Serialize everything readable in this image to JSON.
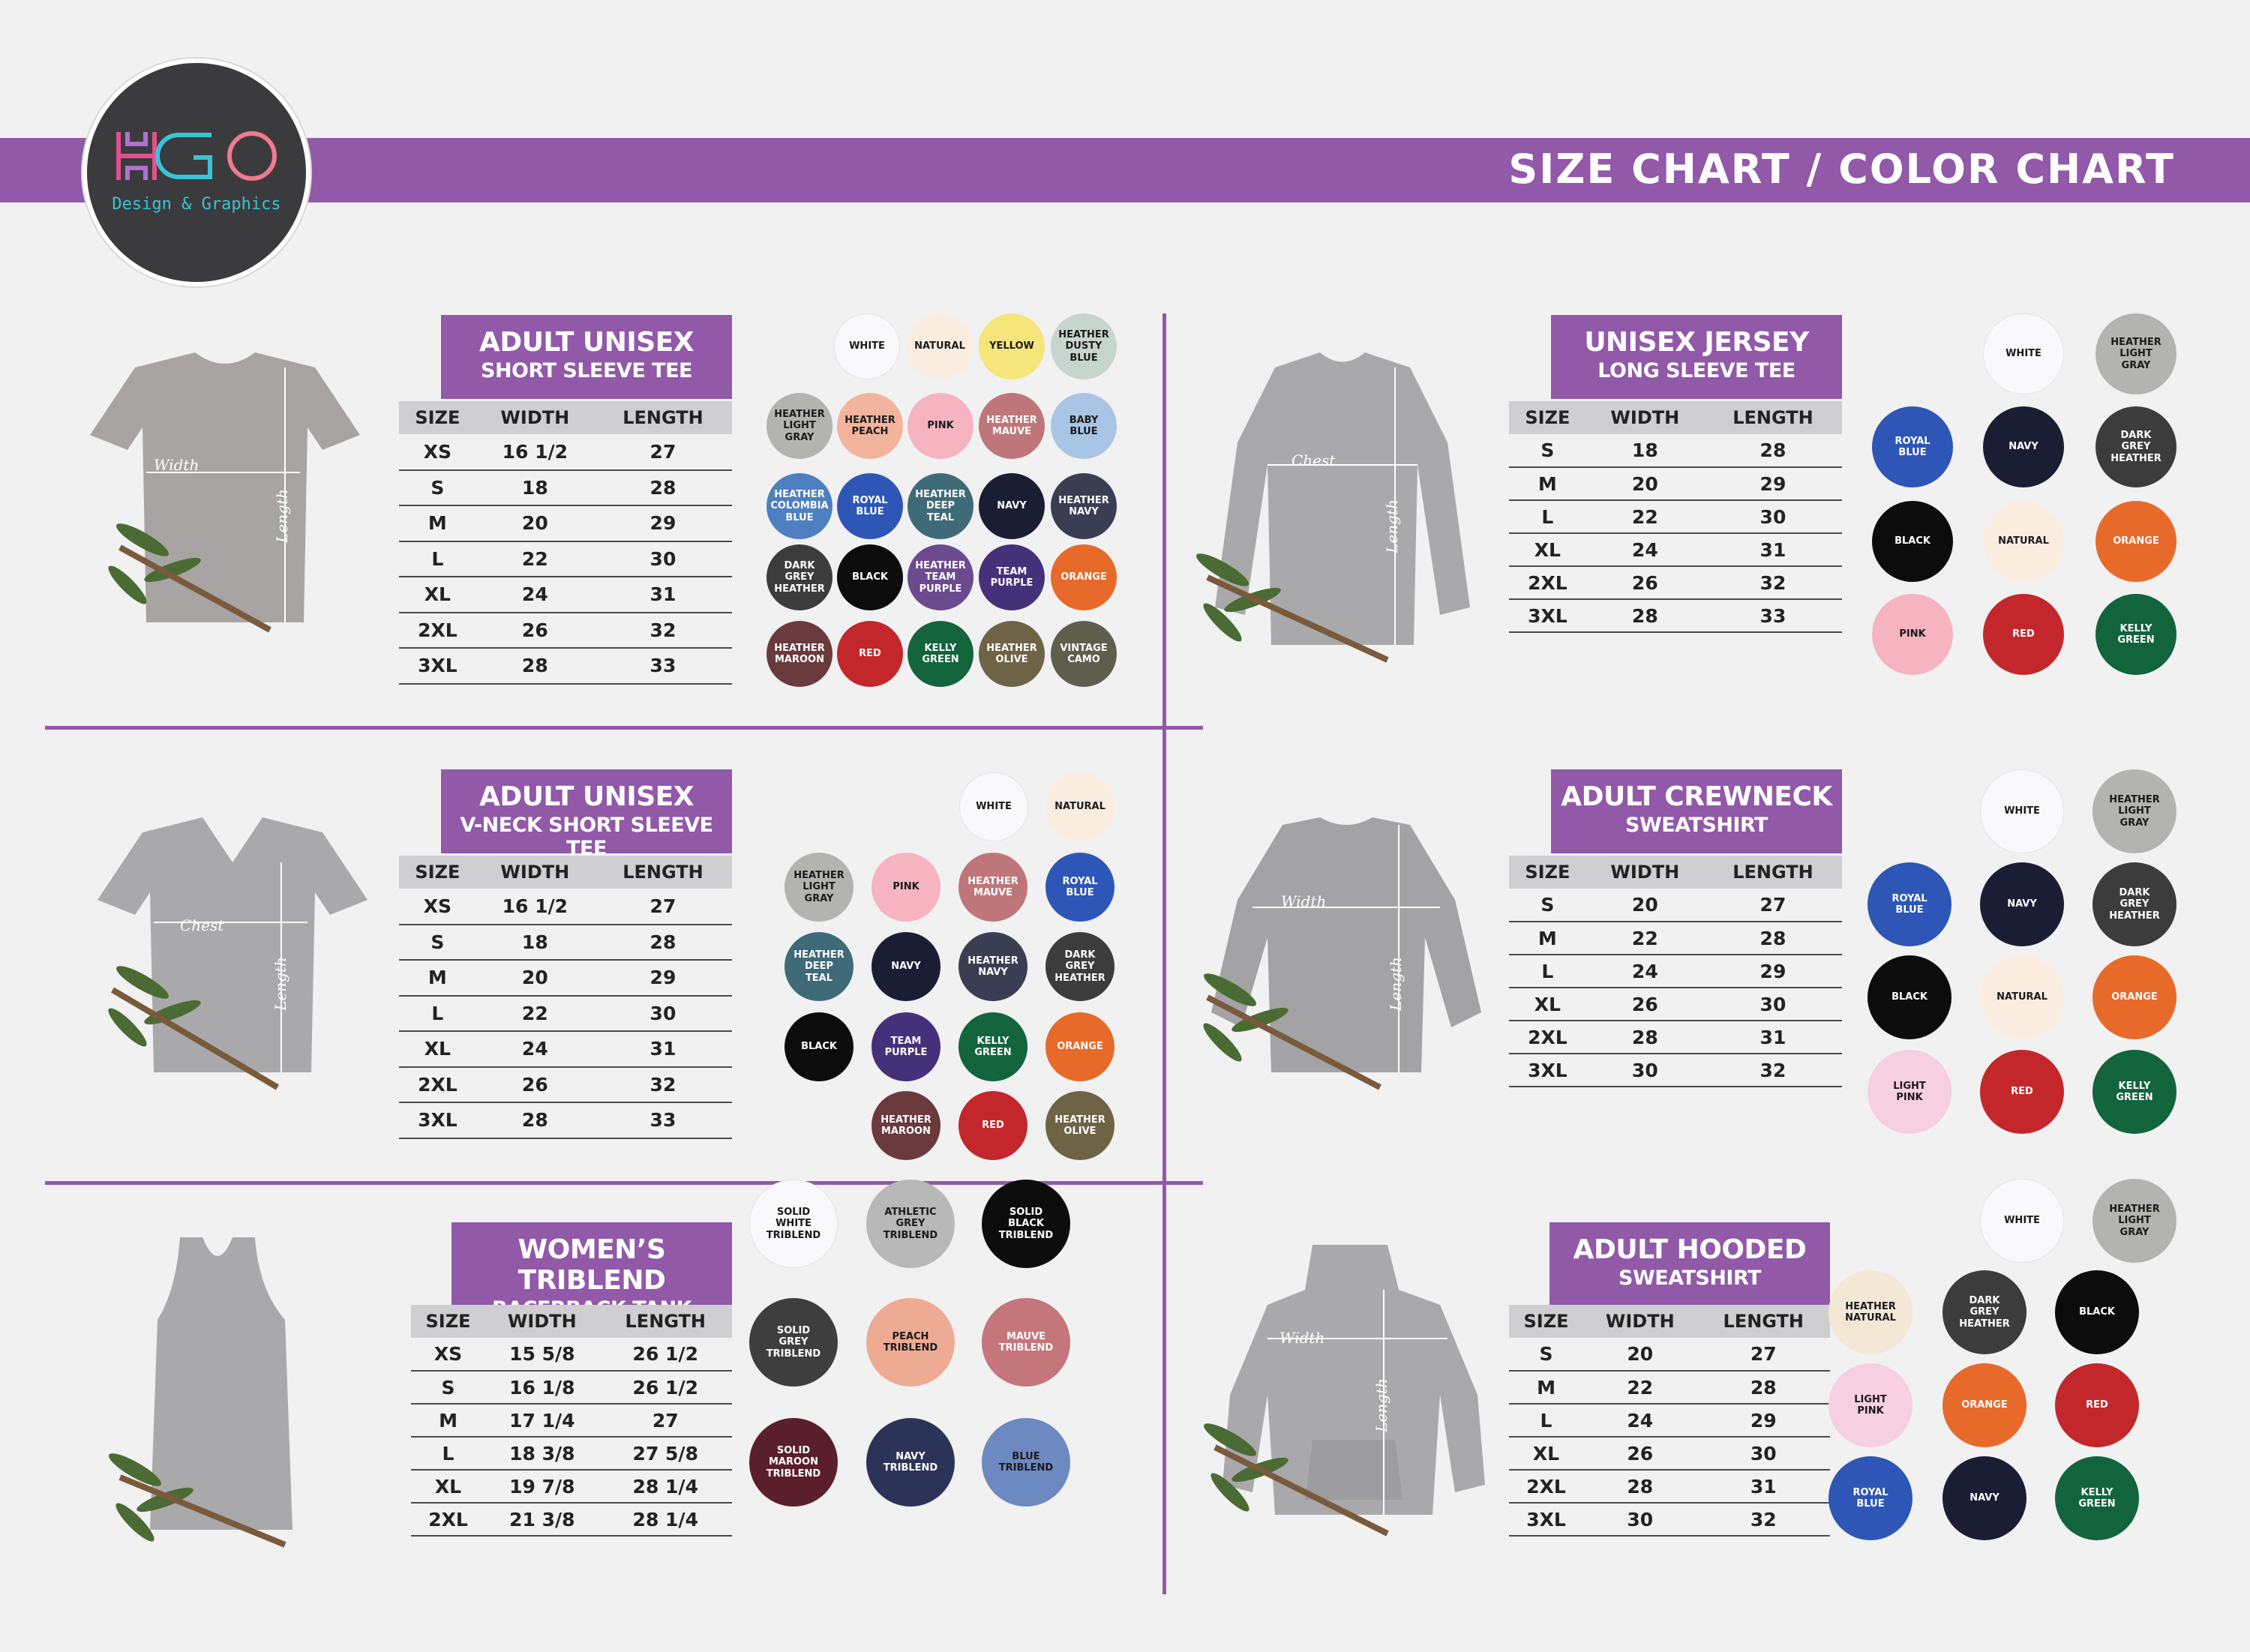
{
  "brand": {
    "logo_text": "Design & Graphics",
    "logo_letters": "HGO"
  },
  "header": {
    "title": "SIZE CHART / COLOR CHART"
  },
  "headers": {
    "size": "SIZE",
    "width": "WIDTH",
    "length": "LENGTH"
  },
  "products": [
    {
      "id": "p1",
      "title_line1": "ADULT UNISEX",
      "title_line2": "SHORT SLEEVE TEE",
      "photo": {
        "kind": "tshirt",
        "width_label": "Width",
        "length_label": "Length"
      },
      "rows": [
        [
          "XS",
          "16 1/2",
          "27"
        ],
        [
          "S",
          "18",
          "28"
        ],
        [
          "M",
          "20",
          "29"
        ],
        [
          "L",
          "22",
          "30"
        ],
        [
          "XL",
          "24",
          "31"
        ],
        [
          "2XL",
          "26",
          "32"
        ],
        [
          "3XL",
          "28",
          "33"
        ]
      ],
      "colors": [
        {
          "name": "WHITE",
          "hex": "#f9f9fb",
          "text": "#1a1a1a"
        },
        {
          "name": "NATURAL",
          "hex": "#faede0",
          "text": "#1a1a1a"
        },
        {
          "name": "YELLOW",
          "hex": "#f5e57a",
          "text": "#1a1a1a"
        },
        {
          "name": "HEATHER\nDUSTY\nBLUE",
          "hex": "#c7d5cf",
          "text": "#1a1a1a"
        },
        {
          "name": "HEATHER\nLIGHT\nGRAY",
          "hex": "#b3b3b1",
          "text": "#1a1a1a"
        },
        {
          "name": "HEATHER\nPEACH",
          "hex": "#f2b49c",
          "text": "#1a1a1a"
        },
        {
          "name": "PINK",
          "hex": "#f5b4bf",
          "text": "#1a1a1a"
        },
        {
          "name": "HEATHER\nMAUVE",
          "hex": "#bf767a",
          "text": "#ffffff"
        },
        {
          "name": "BABY\nBLUE",
          "hex": "#a9c5e5",
          "text": "#1a1a1a"
        },
        {
          "name": "HEATHER\nCOLOMBIA\nBLUE",
          "hex": "#4e7fc0",
          "text": "#ffffff"
        },
        {
          "name": "ROYAL\nBLUE",
          "hex": "#2d56b6",
          "text": "#ffffff"
        },
        {
          "name": "HEATHER\nDEEP\nTEAL",
          "hex": "#3f6a78",
          "text": "#ffffff"
        },
        {
          "name": "NAVY",
          "hex": "#1a1d33",
          "text": "#ffffff"
        },
        {
          "name": "HEATHER\nNAVY",
          "hex": "#3b3e52",
          "text": "#ffffff"
        },
        {
          "name": "DARK\nGREY\nHEATHER",
          "hex": "#3c3c3c",
          "text": "#ffffff"
        },
        {
          "name": "BLACK",
          "hex": "#0c0c0c",
          "text": "#ffffff"
        },
        {
          "name": "HEATHER\nTEAM\nPURPLE",
          "hex": "#6b4b8d",
          "text": "#ffffff"
        },
        {
          "name": "TEAM\nPURPLE",
          "hex": "#45307a",
          "text": "#ffffff"
        },
        {
          "name": "ORANGE",
          "hex": "#e86a2a",
          "text": "#ffffff"
        },
        {
          "name": "HEATHER\nMAROON",
          "hex": "#6b3a3d",
          "text": "#ffffff"
        },
        {
          "name": "RED",
          "hex": "#c3272c",
          "text": "#ffffff"
        },
        {
          "name": "KELLY\nGREEN",
          "hex": "#12643c",
          "text": "#ffffff"
        },
        {
          "name": "HEATHER\nOLIVE",
          "hex": "#6e6445",
          "text": "#ffffff"
        },
        {
          "name": "VINTAGE\nCAMO",
          "hex": "#5e5e4c",
          "text": "#ffffff"
        }
      ]
    },
    {
      "id": "p2",
      "title_line1": "UNISEX JERSEY",
      "title_line2": "LONG SLEEVE TEE",
      "photo": {
        "kind": "longsleeve",
        "width_label": "Chest",
        "length_label": "Length"
      },
      "rows": [
        [
          "S",
          "18",
          "28"
        ],
        [
          "M",
          "20",
          "29"
        ],
        [
          "L",
          "22",
          "30"
        ],
        [
          "XL",
          "24",
          "31"
        ],
        [
          "2XL",
          "26",
          "32"
        ],
        [
          "3XL",
          "28",
          "33"
        ]
      ],
      "colors": [
        {
          "name": "WHITE",
          "hex": "#f9f9fb",
          "text": "#1a1a1a"
        },
        {
          "name": "HEATHER\nLIGHT\nGRAY",
          "hex": "#b3b3b1",
          "text": "#1a1a1a"
        },
        {
          "name": "ROYAL\nBLUE",
          "hex": "#2d56b6",
          "text": "#ffffff"
        },
        {
          "name": "NAVY",
          "hex": "#1a1d33",
          "text": "#ffffff"
        },
        {
          "name": "DARK\nGREY\nHEATHER",
          "hex": "#3c3c3c",
          "text": "#ffffff"
        },
        {
          "name": "BLACK",
          "hex": "#0c0c0c",
          "text": "#ffffff"
        },
        {
          "name": "NATURAL",
          "hex": "#faede0",
          "text": "#1a1a1a"
        },
        {
          "name": "ORANGE",
          "hex": "#e86a2a",
          "text": "#ffffff"
        },
        {
          "name": "PINK",
          "hex": "#f5b4bf",
          "text": "#1a1a1a"
        },
        {
          "name": "RED",
          "hex": "#c3272c",
          "text": "#ffffff"
        },
        {
          "name": "KELLY\nGREEN",
          "hex": "#12643c",
          "text": "#ffffff"
        }
      ]
    },
    {
      "id": "p3",
      "title_line1": "ADULT UNISEX",
      "title_line2": "V-NECK SHORT SLEEVE TEE",
      "photo": {
        "kind": "vneck",
        "width_label": "Chest",
        "length_label": "Length"
      },
      "rows": [
        [
          "XS",
          "16 1/2",
          "27"
        ],
        [
          "S",
          "18",
          "28"
        ],
        [
          "M",
          "20",
          "29"
        ],
        [
          "L",
          "22",
          "30"
        ],
        [
          "XL",
          "24",
          "31"
        ],
        [
          "2XL",
          "26",
          "32"
        ],
        [
          "3XL",
          "28",
          "33"
        ]
      ],
      "colors": [
        {
          "name": "WHITE",
          "hex": "#f9f9fb",
          "text": "#1a1a1a"
        },
        {
          "name": "NATURAL",
          "hex": "#faede0",
          "text": "#1a1a1a"
        },
        {
          "name": "HEATHER\nLIGHT\nGRAY",
          "hex": "#b3b3b1",
          "text": "#1a1a1a"
        },
        {
          "name": "PINK",
          "hex": "#f5b4bf",
          "text": "#1a1a1a"
        },
        {
          "name": "HEATHER\nMAUVE",
          "hex": "#bf767a",
          "text": "#ffffff"
        },
        {
          "name": "ROYAL\nBLUE",
          "hex": "#2d56b6",
          "text": "#ffffff"
        },
        {
          "name": "HEATHER\nDEEP\nTEAL",
          "hex": "#3f6a78",
          "text": "#ffffff"
        },
        {
          "name": "NAVY",
          "hex": "#1a1d33",
          "text": "#ffffff"
        },
        {
          "name": "HEATHER\nNAVY",
          "hex": "#3b3e52",
          "text": "#ffffff"
        },
        {
          "name": "DARK\nGREY\nHEATHER",
          "hex": "#3c3c3c",
          "text": "#ffffff"
        },
        {
          "name": "BLACK",
          "hex": "#0c0c0c",
          "text": "#ffffff"
        },
        {
          "name": "TEAM\nPURPLE",
          "hex": "#45307a",
          "text": "#ffffff"
        },
        {
          "name": "KELLY\nGREEN",
          "hex": "#12643c",
          "text": "#ffffff"
        },
        {
          "name": "ORANGE",
          "hex": "#e86a2a",
          "text": "#ffffff"
        },
        {
          "name": "HEATHER\nMAROON",
          "hex": "#6b3a3d",
          "text": "#ffffff"
        },
        {
          "name": "RED",
          "hex": "#c3272c",
          "text": "#ffffff"
        },
        {
          "name": "HEATHER\nOLIVE",
          "hex": "#6e6445",
          "text": "#ffffff"
        }
      ]
    },
    {
      "id": "p4",
      "title_line1": "ADULT CREWNECK",
      "title_line2": "SWEATSHIRT",
      "photo": {
        "kind": "crewneck",
        "width_label": "Width",
        "length_label": "Length"
      },
      "rows": [
        [
          "S",
          "20",
          "27"
        ],
        [
          "M",
          "22",
          "28"
        ],
        [
          "L",
          "24",
          "29"
        ],
        [
          "XL",
          "26",
          "30"
        ],
        [
          "2XL",
          "28",
          "31"
        ],
        [
          "3XL",
          "30",
          "32"
        ]
      ],
      "colors": [
        {
          "name": "WHITE",
          "hex": "#f9f9fb",
          "text": "#1a1a1a"
        },
        {
          "name": "HEATHER\nLIGHT\nGRAY",
          "hex": "#b3b3b1",
          "text": "#1a1a1a"
        },
        {
          "name": "ROYAL\nBLUE",
          "hex": "#2d56b6",
          "text": "#ffffff"
        },
        {
          "name": "NAVY",
          "hex": "#1a1d33",
          "text": "#ffffff"
        },
        {
          "name": "DARK\nGREY\nHEATHER",
          "hex": "#3c3c3c",
          "text": "#ffffff"
        },
        {
          "name": "BLACK",
          "hex": "#0c0c0c",
          "text": "#ffffff"
        },
        {
          "name": "NATURAL",
          "hex": "#faede0",
          "text": "#1a1a1a"
        },
        {
          "name": "ORANGE",
          "hex": "#e86a2a",
          "text": "#ffffff"
        },
        {
          "name": "LIGHT\nPINK",
          "hex": "#f6cfe0",
          "text": "#1a1a1a"
        },
        {
          "name": "RED",
          "hex": "#c3272c",
          "text": "#ffffff"
        },
        {
          "name": "KELLY\nGREEN",
          "hex": "#12643c",
          "text": "#ffffff"
        }
      ]
    },
    {
      "id": "p5",
      "title_line1": "WOMEN’S TRIBLEND",
      "title_line2": "RACERBACK TANK",
      "photo": {
        "kind": "tank",
        "width_label": "",
        "length_label": ""
      },
      "rows": [
        [
          "XS",
          "15 5/8",
          "26 1/2"
        ],
        [
          "S",
          "16 1/8",
          "26 1/2"
        ],
        [
          "M",
          "17 1/4",
          "27"
        ],
        [
          "L",
          "18 3/8",
          "27 5/8"
        ],
        [
          "XL",
          "19 7/8",
          "28 1/4"
        ],
        [
          "2XL",
          "21 3/8",
          "28 1/4"
        ]
      ],
      "colors": [
        {
          "name": "SOLID\nWHITE\nTRIBLEND",
          "hex": "#f9f9fb",
          "text": "#1a1a1a"
        },
        {
          "name": "ATHLETIC\nGREY\nTRIBLEND",
          "hex": "#b8b8b8",
          "text": "#1a1a1a"
        },
        {
          "name": "SOLID\nBLACK\nTRIBLEND",
          "hex": "#0c0c0c",
          "text": "#ffffff"
        },
        {
          "name": "SOLID\nGREY\nTRIBLEND",
          "hex": "#3e3e3e",
          "text": "#ffffff"
        },
        {
          "name": "PEACH\nTRIBLEND",
          "hex": "#eeab93",
          "text": "#1a1a1a"
        },
        {
          "name": "MAUVE\nTRIBLEND",
          "hex": "#c4767b",
          "text": "#ffffff"
        },
        {
          "name": "SOLID\nMAROON\nTRIBLEND",
          "hex": "#5a1f2a",
          "text": "#ffffff"
        },
        {
          "name": "NAVY\nTRIBLEND",
          "hex": "#2b3358",
          "text": "#ffffff"
        },
        {
          "name": "BLUE\nTRIBLEND",
          "hex": "#6d89c2",
          "text": "#1a1a1a"
        }
      ]
    },
    {
      "id": "p6",
      "title_line1": "ADULT HOODED",
      "title_line2": "SWEATSHIRT",
      "photo": {
        "kind": "hoodie",
        "width_label": "Width",
        "length_label": "Length"
      },
      "rows": [
        [
          "S",
          "20",
          "27"
        ],
        [
          "M",
          "22",
          "28"
        ],
        [
          "L",
          "24",
          "29"
        ],
        [
          "XL",
          "26",
          "30"
        ],
        [
          "2XL",
          "28",
          "31"
        ],
        [
          "3XL",
          "30",
          "32"
        ]
      ],
      "colors": [
        {
          "name": "WHITE",
          "hex": "#f9f9fb",
          "text": "#1a1a1a"
        },
        {
          "name": "HEATHER\nLIGHT\nGRAY",
          "hex": "#b3b3b1",
          "text": "#1a1a1a"
        },
        {
          "name": "HEATHER\nNATURAL",
          "hex": "#f3e7d6",
          "text": "#1a1a1a"
        },
        {
          "name": "DARK\nGREY\nHEATHER",
          "hex": "#3c3c3c",
          "text": "#ffffff"
        },
        {
          "name": "BLACK",
          "hex": "#0c0c0c",
          "text": "#ffffff"
        },
        {
          "name": "LIGHT\nPINK",
          "hex": "#f6cfe0",
          "text": "#1a1a1a"
        },
        {
          "name": "ORANGE",
          "hex": "#e86a2a",
          "text": "#ffffff"
        },
        {
          "name": "RED",
          "hex": "#c3272c",
          "text": "#ffffff"
        },
        {
          "name": "ROYAL\nBLUE",
          "hex": "#2d56b6",
          "text": "#ffffff"
        },
        {
          "name": "NAVY",
          "hex": "#1a1d33",
          "text": "#ffffff"
        },
        {
          "name": "KELLY\nGREEN",
          "hex": "#12643c",
          "text": "#ffffff"
        }
      ]
    }
  ]
}
